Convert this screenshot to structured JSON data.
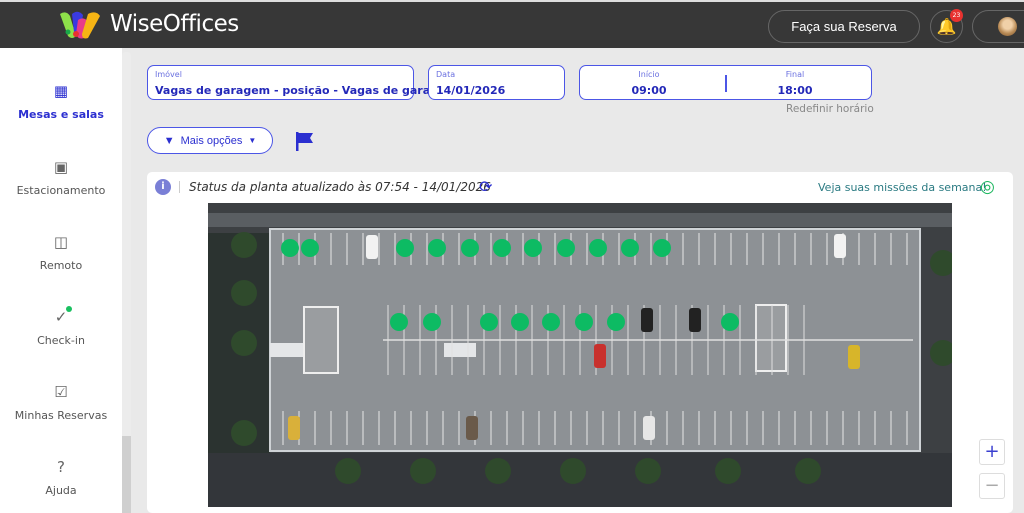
{
  "header": {
    "brand": "WiseOffices",
    "reserve_button": "Faça sua Reserva",
    "notifications_count": "23"
  },
  "sidebar": {
    "items": [
      {
        "label": "Mesas e salas",
        "icon": "building-icon",
        "active": true
      },
      {
        "label": "Estacionamento",
        "icon": "car-icon"
      },
      {
        "label": "Remoto",
        "icon": "monitor-icon"
      },
      {
        "label": "Check-in",
        "icon": "check-circle-icon"
      },
      {
        "label": "Minhas Reservas",
        "icon": "calendar-check-icon"
      },
      {
        "label": "Ajuda",
        "icon": "help-circle-icon"
      }
    ]
  },
  "filters": {
    "property": {
      "label": "Imóvel",
      "value": "Vagas de garagem - posição - Vagas de garagem"
    },
    "date": {
      "label": "Data",
      "value": "14/01/2026"
    },
    "start": {
      "label": "Início",
      "value": "09:00"
    },
    "end": {
      "label": "Final",
      "value": "18:00"
    },
    "reset_time": "Redefinir horário",
    "more_options": "Mais opções"
  },
  "map": {
    "status_text": "Status da planta atualizado às 07:54 - 14/01/2026",
    "missions_link": "Veja suas missões da semana!",
    "available_spot_color": "#0dbb63",
    "available_spots": 19,
    "zoom_in": "+",
    "zoom_out": "−"
  },
  "colors": {
    "accent": "#2b2fd0",
    "topbar": "#373737"
  }
}
